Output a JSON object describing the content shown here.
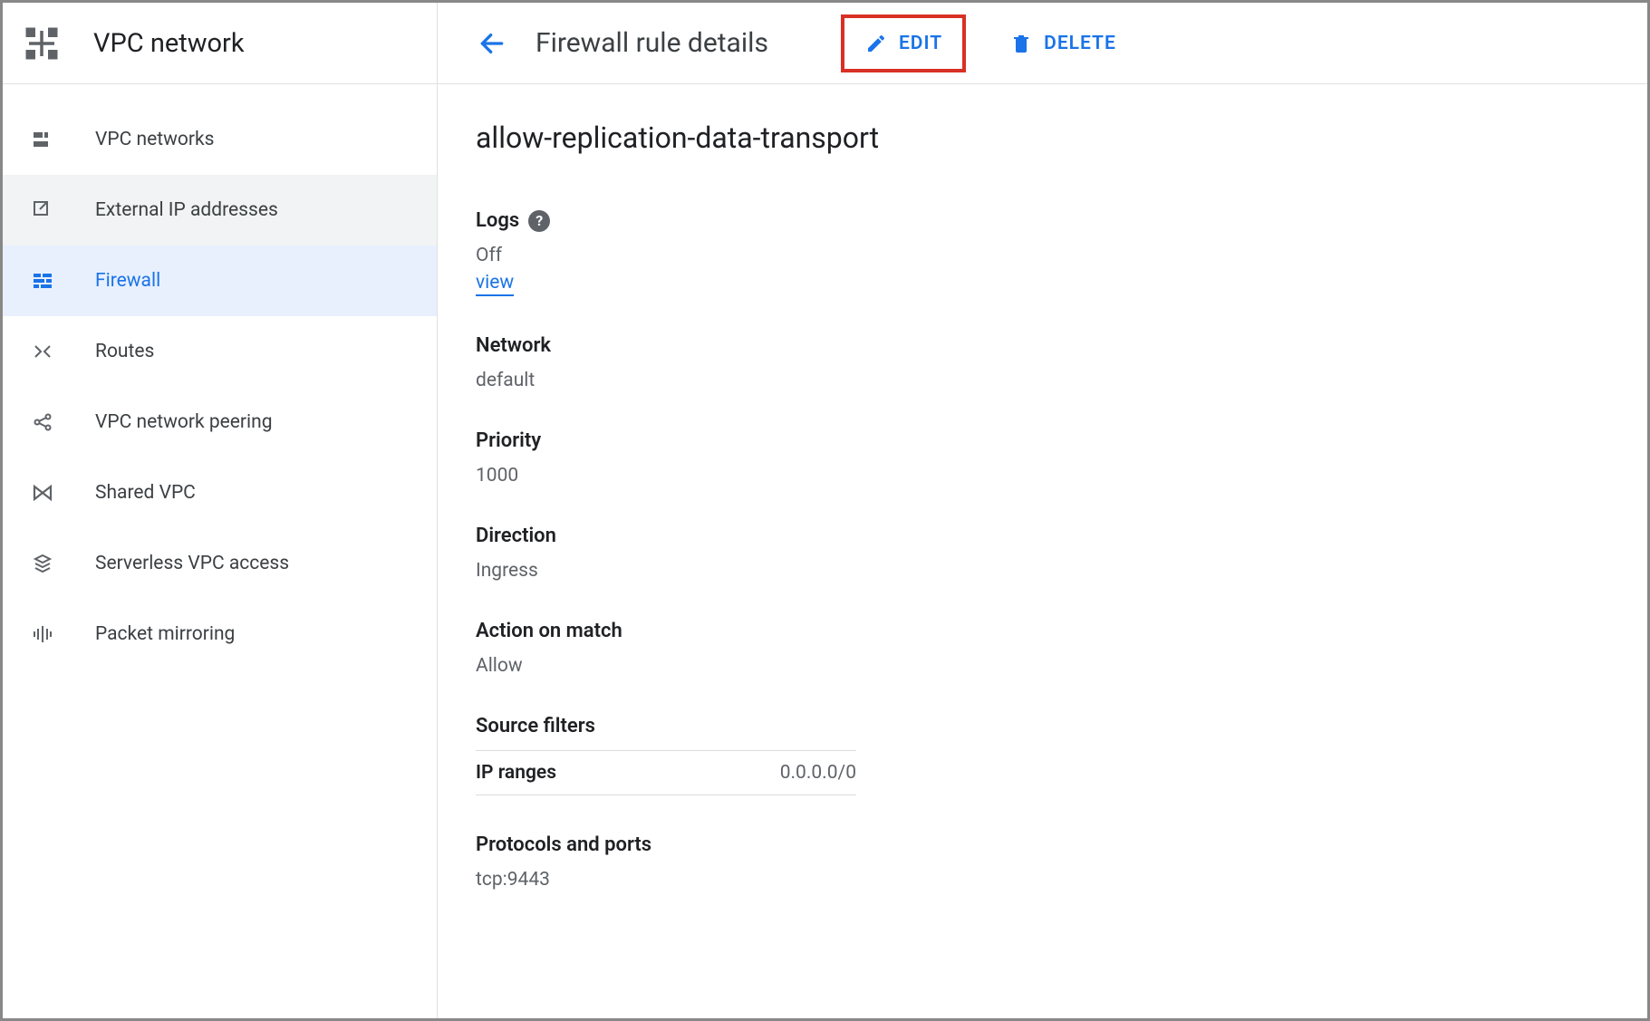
{
  "sidebar": {
    "title": "VPC network",
    "items": [
      {
        "label": "VPC networks"
      },
      {
        "label": "External IP addresses"
      },
      {
        "label": "Firewall"
      },
      {
        "label": "Routes"
      },
      {
        "label": "VPC network peering"
      },
      {
        "label": "Shared VPC"
      },
      {
        "label": "Serverless VPC access"
      },
      {
        "label": "Packet mirroring"
      }
    ]
  },
  "header": {
    "page_title": "Firewall rule details",
    "edit_label": "EDIT",
    "delete_label": "DELETE"
  },
  "rule": {
    "name": "allow-replication-data-transport",
    "logs": {
      "label": "Logs",
      "value": "Off",
      "link": "view"
    },
    "network": {
      "label": "Network",
      "value": "default"
    },
    "priority": {
      "label": "Priority",
      "value": "1000"
    },
    "direction": {
      "label": "Direction",
      "value": "Ingress"
    },
    "action": {
      "label": "Action on match",
      "value": "Allow"
    },
    "source_filters": {
      "label": "Source filters",
      "rows": [
        {
          "k": "IP ranges",
          "v": "0.0.0.0/0"
        }
      ]
    },
    "protocols": {
      "label": "Protocols and ports",
      "value": "tcp:9443"
    }
  }
}
